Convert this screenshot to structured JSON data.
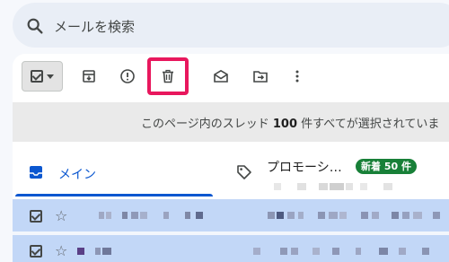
{
  "search": {
    "placeholder": "メールを検索",
    "icon": "search-icon"
  },
  "toolbar": {
    "select_icon": "checkbox-checked-icon",
    "buttons": [
      {
        "name": "archive",
        "icon": "archive-icon"
      },
      {
        "name": "report-spam",
        "icon": "report-spam-icon"
      },
      {
        "name": "delete",
        "icon": "trash-icon",
        "highlighted": true
      },
      {
        "name": "mark-as-read",
        "icon": "mark-read-icon"
      },
      {
        "name": "move-to",
        "icon": "move-to-icon"
      },
      {
        "name": "more",
        "icon": "more-vert-icon"
      }
    ],
    "highlight_color": "#e8175d"
  },
  "banner": {
    "prefix": "このページ内のスレッド ",
    "count": "100",
    "suffix": " 件すべてが選択されていま"
  },
  "tabs": [
    {
      "label": "メイン",
      "icon": "inbox-icon",
      "active": true,
      "color": "#0b57d0"
    },
    {
      "label": "プロモーシ…",
      "icon": "tag-icon",
      "badge": "新着 50 件",
      "badge_color": "#188038"
    }
  ],
  "rows": [
    {
      "selected": true,
      "starred": false
    },
    {
      "selected": true,
      "starred": false
    }
  ],
  "colors": {
    "selected_row": "#c2d7f7",
    "accent": "#0b57d0"
  }
}
